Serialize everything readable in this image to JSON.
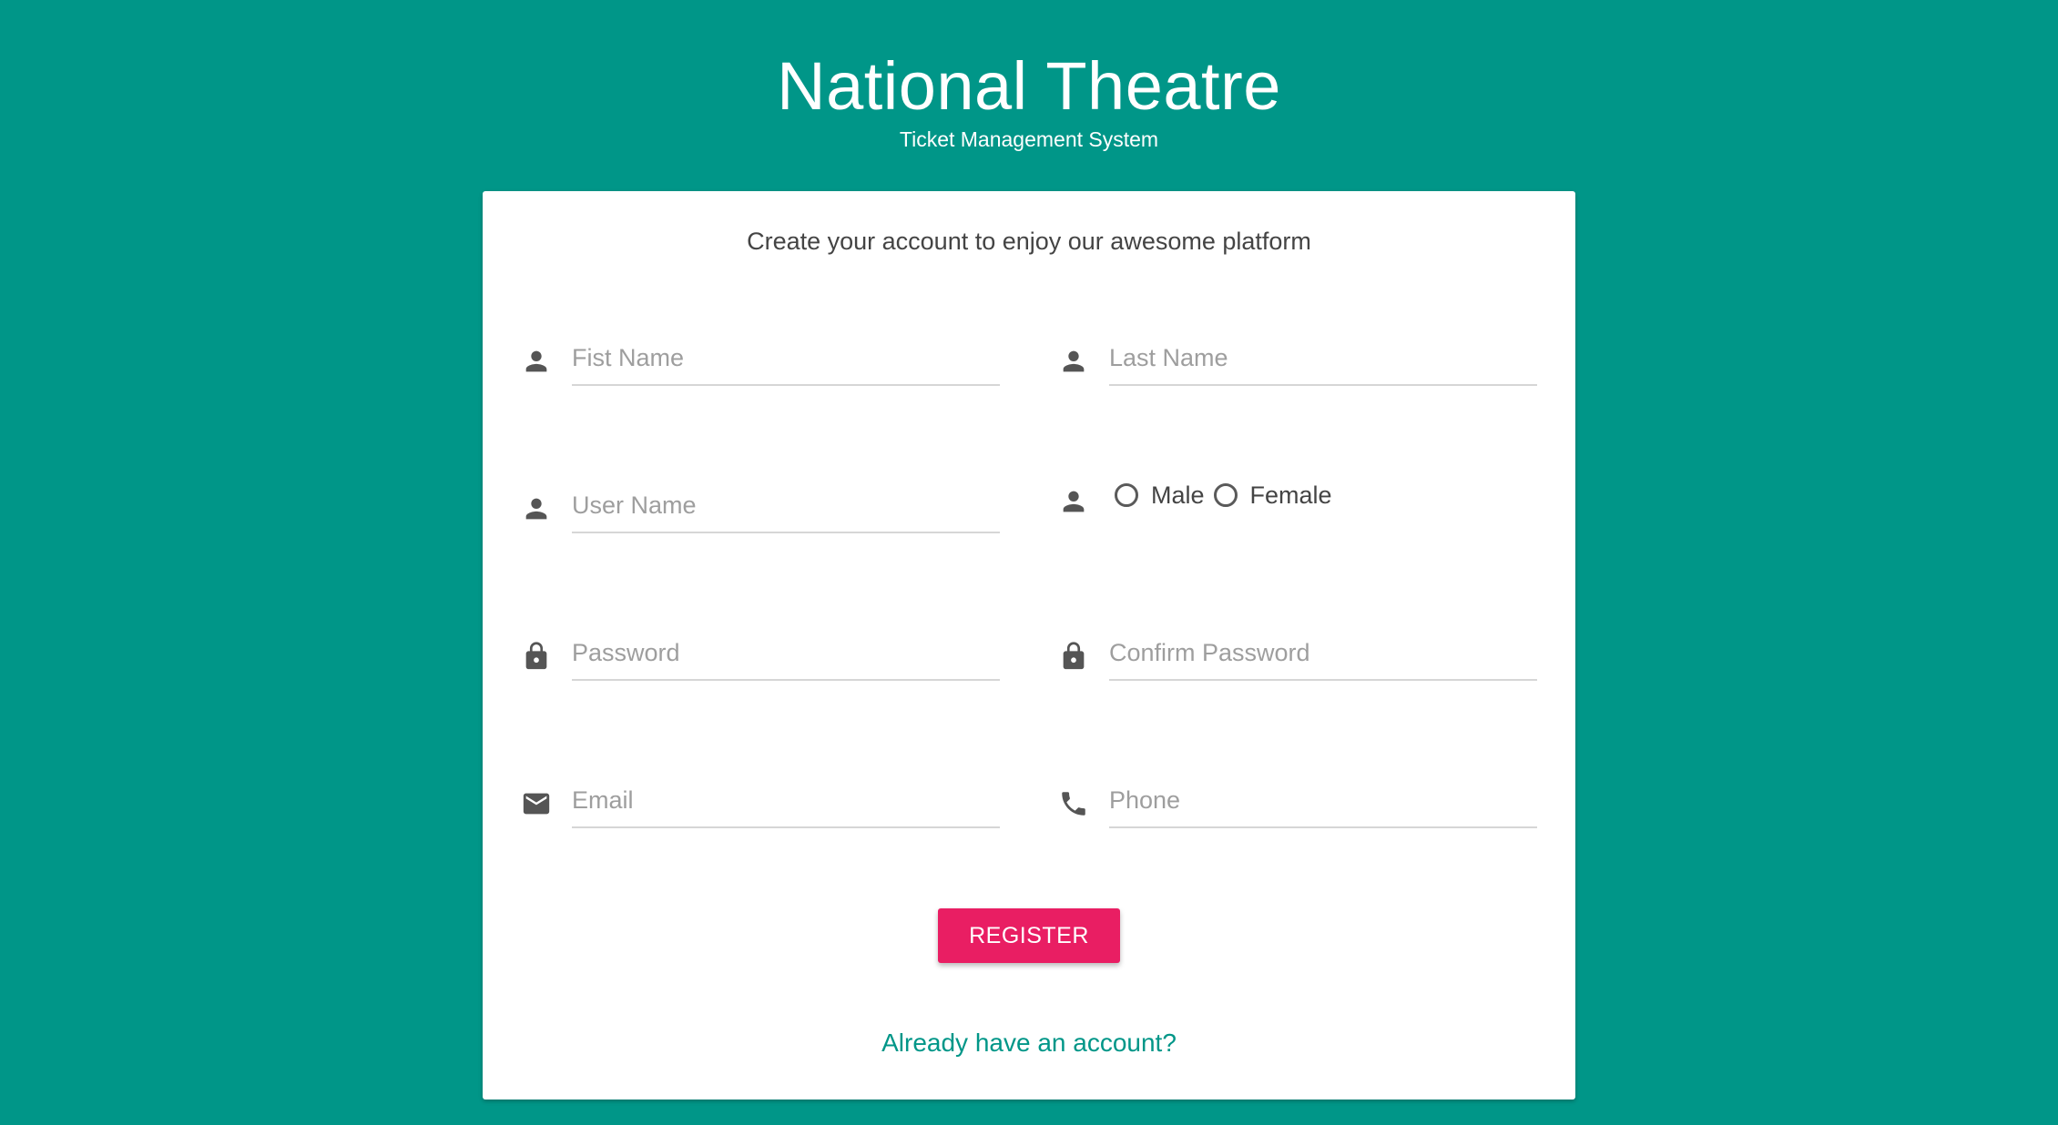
{
  "header": {
    "title": "National Theatre",
    "subtitle": "Ticket Management System"
  },
  "form": {
    "intro": "Create your account to enjoy our awesome platform",
    "first_name": {
      "placeholder": "Fist Name",
      "value": "",
      "icon": "person-icon"
    },
    "last_name": {
      "placeholder": "Last Name",
      "value": "",
      "icon": "person-icon"
    },
    "user_name": {
      "placeholder": "User Name",
      "value": "",
      "icon": "person-icon"
    },
    "gender": {
      "icon": "person-icon",
      "options": [
        "Male",
        "Female"
      ],
      "selected": null
    },
    "password": {
      "placeholder": "Password",
      "value": "",
      "icon": "lock-icon"
    },
    "confirm_password": {
      "placeholder": "Confirm Password",
      "value": "",
      "icon": "lock-icon"
    },
    "email": {
      "placeholder": "Email",
      "value": "",
      "icon": "mail-icon"
    },
    "phone": {
      "placeholder": "Phone",
      "value": "",
      "icon": "phone-icon"
    },
    "register_label": "REGISTER",
    "login_link": "Already have an account?"
  },
  "colors": {
    "background": "#009688",
    "accent": "#e91e63",
    "link": "#009688",
    "icon": "#555555"
  }
}
